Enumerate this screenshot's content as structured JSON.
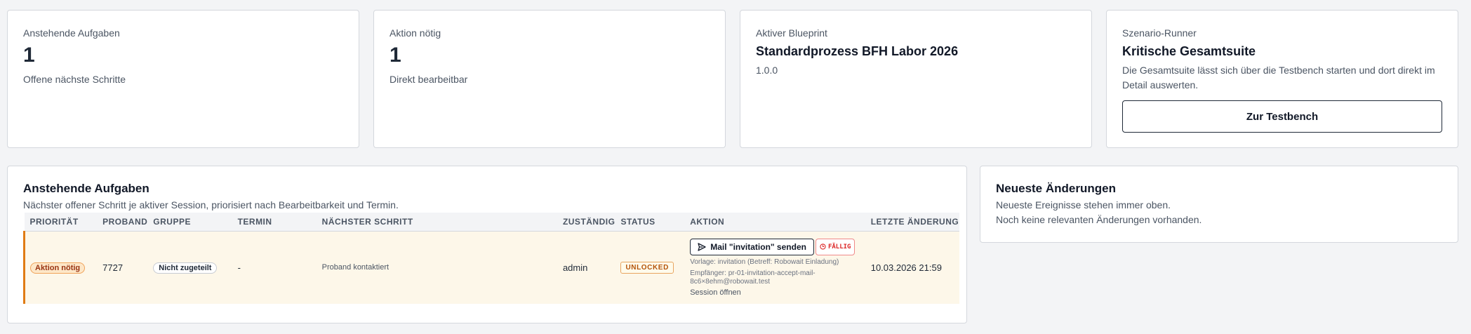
{
  "stats": [
    {
      "label": "Anstehende Aufgaben",
      "value": "1",
      "sub": "Offene nächste Schritte"
    },
    {
      "label": "Aktion nötig",
      "value": "1",
      "sub": "Direkt bearbeitbar"
    }
  ],
  "blueprint": {
    "label": "Aktiver Blueprint",
    "name": "Standardprozess BFH Labor 2026",
    "version": "1.0.0"
  },
  "runner": {
    "label": "Szenario-Runner",
    "title": "Kritische Gesamtsuite",
    "description": "Die Gesamtsuite lässt sich über die Testbench starten und dort direkt im Detail auswerten.",
    "button_label": "Zur Testbench"
  },
  "tasks": {
    "title": "Anstehende Aufgaben",
    "subtitle": "Nächster offener Schritt je aktiver Session, priorisiert nach Bearbeitbarkeit und Termin.",
    "columns": [
      "Priorität",
      "Proband",
      "Gruppe",
      "Termin",
      "Nächster Schritt",
      "Zuständig",
      "Status",
      "Aktion",
      "Letzte Änderung"
    ],
    "rows": [
      {
        "priority": "Aktion nötig",
        "proband": "7727",
        "group": "Nicht zugeteilt",
        "termin": "-",
        "next_step": "Proband kontaktiert",
        "assignee": "admin",
        "status": "UNLOCKED",
        "action_label": "Mail \"invitation\" senden",
        "due_label": "FÄLLIG",
        "template_info": "Vorlage: invitation (Betreff: Robowait Einladung)",
        "recipient_info": "Empfänger: pr-01-invitation-accept-mail-8c6×8ehm@robowait.test",
        "session_link": "Session öffnen",
        "last_change": "10.03.2026 21:59"
      }
    ]
  },
  "changes": {
    "title": "Neueste Änderungen",
    "line1": "Neueste Ereignisse stehen immer oben.",
    "line2": "Noch keine relevanten Änderungen vorhanden."
  },
  "colors": {
    "accent_row_bar": "#e07b14",
    "row_background": "#fdf7e9",
    "due_red": "#dc2626"
  }
}
